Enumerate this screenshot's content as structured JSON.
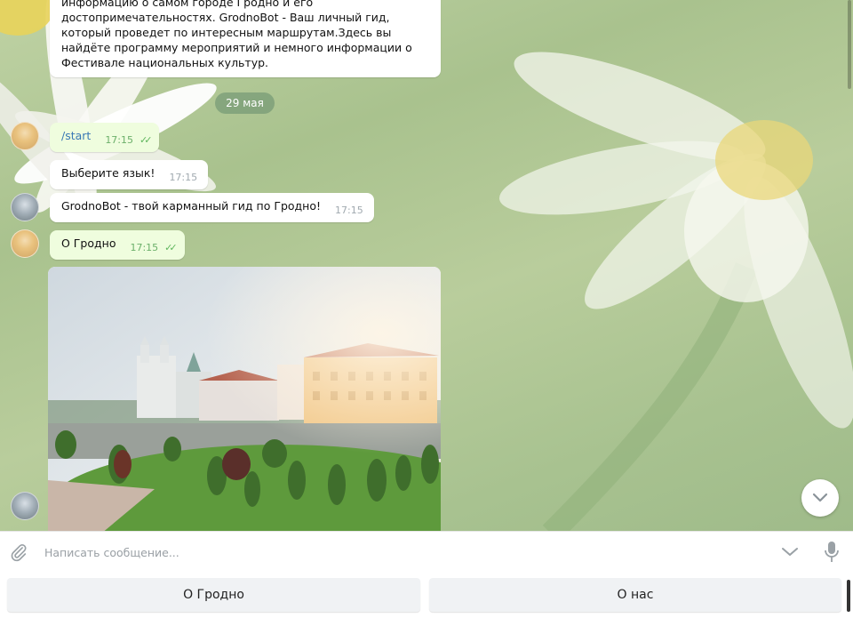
{
  "chat": {
    "intro_message": {
      "lines": [
        "информацию о самом городе Гродно и его",
        "достопримечательностях.  GrodnoBot - Ваш личный гид,",
        "который проведет по интересным маршрутам.Здесь вы",
        "найдёте программу мероприятий и немного информации о",
        "Фестивале национальных культур."
      ]
    },
    "date_separator": "29 мая",
    "messages": [
      {
        "from": "user",
        "text": "/start",
        "time": "17:15",
        "read": true
      },
      {
        "from": "bot",
        "text": "Выберите язык!",
        "time": "17:15"
      },
      {
        "from": "bot",
        "text": "GrodnoBot - твой карманный гид по Гродно!",
        "time": "17:15"
      },
      {
        "from": "user",
        "text": "О Гродно",
        "time": "17:15",
        "read": true
      }
    ],
    "check_glyph": "✓✓"
  },
  "composer": {
    "placeholder": "Написать сообщение..."
  },
  "keyboard": {
    "buttons": [
      {
        "label": "О Гродно"
      },
      {
        "label": "О нас"
      }
    ]
  },
  "icons": {
    "attach": "paperclip-icon",
    "keyboard_toggle": "chevron-down-icon",
    "mic": "microphone-icon",
    "scroll_down": "chevron-down-icon"
  },
  "colors": {
    "outgoing_bubble": "#effdde",
    "incoming_bubble": "#ffffff",
    "check_marks": "#5fb65d",
    "wallpaper": "#b5cb99",
    "keyboard_button": "#f0f2f4"
  }
}
